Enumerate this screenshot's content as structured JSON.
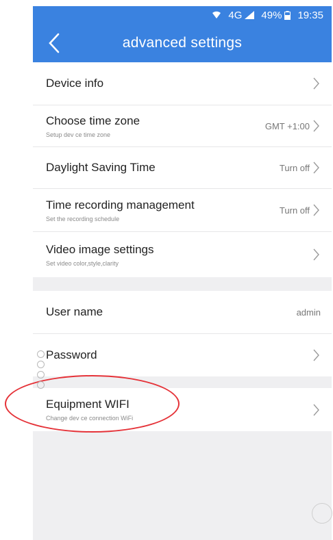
{
  "status_bar": {
    "network": "4G",
    "battery": "49%",
    "time": "19:35"
  },
  "header": {
    "title": "advanced settings",
    "back_icon": "chevron-left-icon"
  },
  "groups": [
    {
      "items": [
        {
          "id": "device-info",
          "label": "Device info",
          "subtitle": "",
          "value": ""
        },
        {
          "id": "time-zone",
          "label": "Choose time zone",
          "subtitle": "Setup dev ce time zone",
          "value": "GMT +1:00"
        },
        {
          "id": "daylight-saving",
          "label": "Daylight Saving Time",
          "subtitle": "",
          "value": "Turn off"
        },
        {
          "id": "time-recording",
          "label": "Time recording management",
          "subtitle": "Set the recording schedule",
          "value": "Turn off"
        },
        {
          "id": "video-image",
          "label": "Video image settings",
          "subtitle": "Set video color,style,clarity",
          "value": ""
        }
      ]
    },
    {
      "items": [
        {
          "id": "user-name",
          "label": "User name",
          "subtitle": "",
          "value": "admin"
        },
        {
          "id": "password",
          "label": "Password",
          "subtitle": "",
          "value": ""
        }
      ]
    },
    {
      "items": [
        {
          "id": "equipment-wifi",
          "label": "Equipment WIFI",
          "subtitle": "Change dev ce connection WiFi",
          "value": ""
        }
      ]
    }
  ],
  "colors": {
    "header_blue": "#3a82e0",
    "annotation_red": "#e53238"
  }
}
